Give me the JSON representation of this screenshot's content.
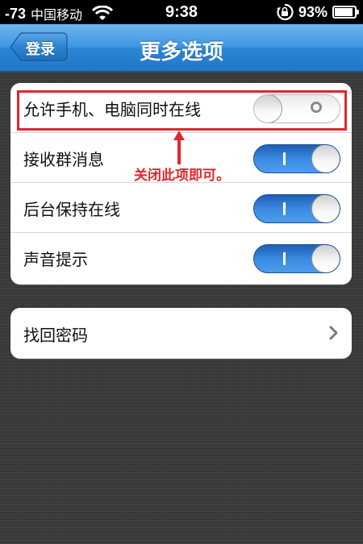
{
  "status_bar": {
    "signal": "-73",
    "carrier": "中国移动",
    "time": "9:38",
    "battery_percent": "93%",
    "battery_level": 0.93,
    "icons": [
      "wifi-icon",
      "rotation-lock-icon",
      "battery-icon"
    ]
  },
  "navbar": {
    "back_label": "登录",
    "title": "更多选项"
  },
  "settings_group": {
    "items": [
      {
        "label": "允许手机、电脑同时在线",
        "toggle_on": false
      },
      {
        "label": "接收群消息",
        "toggle_on": true
      },
      {
        "label": "后台保持在线",
        "toggle_on": true
      },
      {
        "label": "声音提示",
        "toggle_on": true
      }
    ]
  },
  "password_group": {
    "label": "找回密码",
    "icon": "chevron-right-icon"
  },
  "annotation": {
    "text": "关闭此项即可。",
    "color": "#e0272c"
  },
  "colors": {
    "nav_blue": "#3e97e2",
    "toggle_on_blue": "#3a8ae2",
    "background": "#3a3a3a"
  }
}
